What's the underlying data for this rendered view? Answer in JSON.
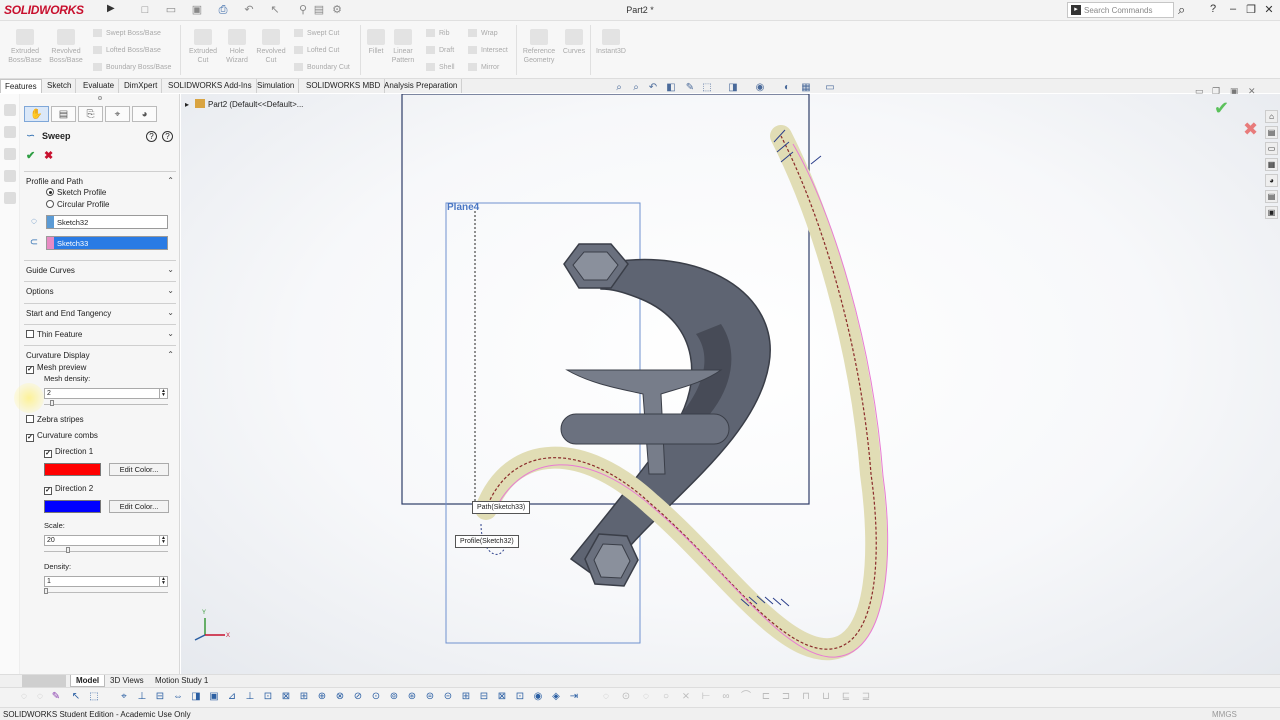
{
  "app": {
    "logo": "SOLIDWORKS",
    "document_title": "Part2 *"
  },
  "search": {
    "placeholder": "Search Commands"
  },
  "ribbon": {
    "extruded_boss": "Extruded Boss/Base",
    "revolved_boss": "Revolved Boss/Base",
    "swept_boss": "Swept Boss/Base",
    "lofted_boss": "Lofted Boss/Base",
    "boundary_boss": "Boundary Boss/Base",
    "extruded_cut": "Extruded Cut",
    "hole_wizard": "Hole Wizard",
    "revolved_cut": "Revolved Cut",
    "swept_cut": "Swept Cut",
    "lofted_cut": "Lofted Cut",
    "boundary_cut": "Boundary Cut",
    "fillet": "Fillet",
    "linear_pattern": "Linear Pattern",
    "rib": "Rib",
    "draft": "Draft",
    "shell": "Shell",
    "wrap": "Wrap",
    "intersect": "Intersect",
    "mirror": "Mirror",
    "reference_geometry": "Reference Geometry",
    "curves": "Curves",
    "instant3d": "Instant3D"
  },
  "tabs": [
    "Features",
    "Sketch",
    "Evaluate",
    "DimXpert",
    "SOLIDWORKS Add-Ins",
    "Simulation",
    "SOLIDWORKS MBD",
    "Analysis Preparation"
  ],
  "property_manager": {
    "title": "Sweep",
    "sections": {
      "profile_and_path": "Profile and Path",
      "guide_curves": "Guide Curves",
      "options": "Options",
      "start_end_tangency": "Start and End Tangency",
      "thin_feature": "Thin Feature",
      "curvature_display": "Curvature Display"
    },
    "sketch_profile": "Sketch Profile",
    "circular_profile": "Circular Profile",
    "profile_value": "Sketch32",
    "path_value": "Sketch33",
    "mesh_preview": "Mesh preview",
    "mesh_density_label": "Mesh density:",
    "mesh_density_value": "2",
    "mesh_density_level": 0.05,
    "zebra_stripes": "Zebra stripes",
    "curvature_combs": "Curvature combs",
    "direction1": "Direction 1",
    "direction2": "Direction 2",
    "direction1_color": "#ff0000",
    "direction2_color": "#0000ff",
    "edit_color": "Edit Color...",
    "scale_label": "Scale:",
    "scale_value": "20",
    "scale_level": 0.19,
    "density_label": "Density:",
    "density_value": "1",
    "density_level": 0.0
  },
  "viewport": {
    "tree_label": "Part2  (Default<<Default>...",
    "plane_label": "Plane4",
    "path_callout": "Path(Sketch33)",
    "profile_callout": "Profile(Sketch32)",
    "triad_x": "X",
    "triad_y": "Y"
  },
  "bottom_tabs": [
    "Model",
    "3D Views",
    "Motion Study 1"
  ],
  "status": {
    "left": "SOLIDWORKS Student Edition - Academic Use Only",
    "right": "MMGS"
  },
  "colors": {
    "accent": "#c8102e",
    "selection": "#2a7be4",
    "plane": "#4a77c4"
  }
}
